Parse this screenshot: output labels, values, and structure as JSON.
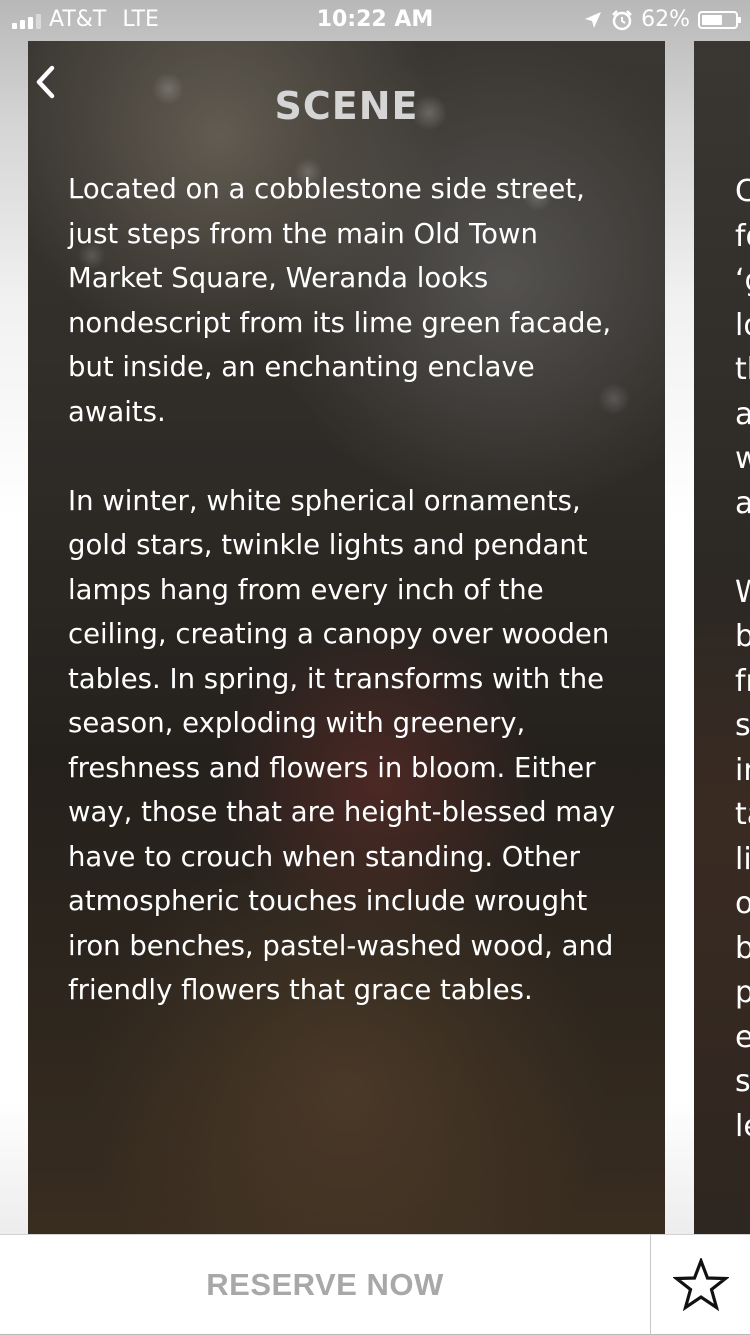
{
  "status_bar": {
    "carrier": "AT&T",
    "network": "LTE",
    "time": "10:22 AM",
    "battery_percent": "62%",
    "battery_level": 0.62,
    "signal_bars_active": 3,
    "signal_bars_total": 4
  },
  "page": {
    "title": "SCENE",
    "paragraphs": [
      "Located on a cobblestone side street, just steps from the main Old Town Market Square, Weranda looks nondescript from its lime green facade, but inside, an enchanting enclave awaits.",
      "In winter, white spherical ornaments, gold stars, twinkle lights and pendant lamps hang from every inch of the ceiling, creating a canopy over wooden tables. In spring, it transforms with the season, exploding with greenery, freshness and flowers in bloom. Either way, those that are height-blessed may have to crouch when standing. Other atmospheric touches include wrought iron benches, pastel-washed wood, and friendly flowers that grace tables."
    ]
  },
  "next_card_peek": [
    "C",
    "fo",
    "‘g",
    "lo",
    "th",
    "a",
    "w",
    "a",
    "",
    "W",
    "b",
    "fr",
    "st",
    "in",
    "ta",
    "li",
    "o",
    "b",
    "p",
    "e",
    "st",
    "le"
  ],
  "bottom_bar": {
    "reserve_label": "RESERVE NOW"
  },
  "icons": {
    "back": "chevron-left-icon",
    "favorite": "star-outline-icon",
    "location": "location-arrow-icon",
    "alarm": "alarm-clock-icon",
    "battery": "battery-icon"
  },
  "colors": {
    "title": "#d5d5d5",
    "reserve_text": "#a8a8a8",
    "body_text": "#ffffff"
  }
}
